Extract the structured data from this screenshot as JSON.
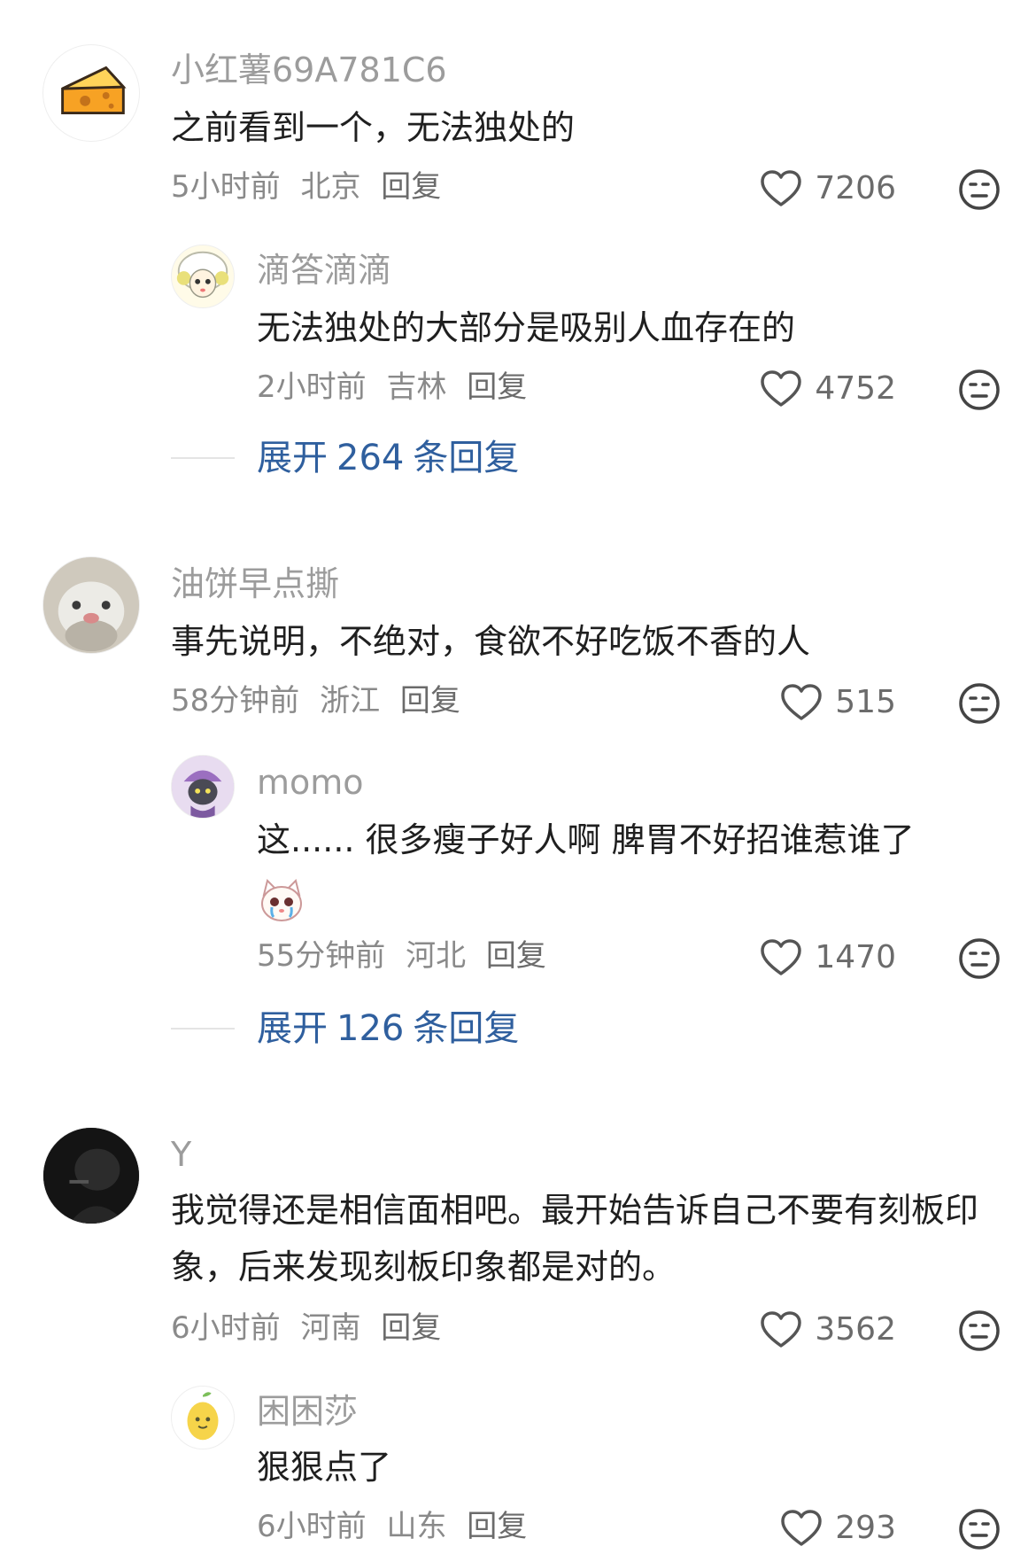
{
  "comments": [
    {
      "username": "小红薯69A781C6",
      "text": "之前看到一个，无法独处的",
      "time": "5小时前",
      "location": "北京",
      "reply_label": "回复",
      "likes": "7206",
      "replies": [
        {
          "username": "滴答滴滴",
          "text": "无法独处的大部分是吸别人血存在的",
          "time": "2小时前",
          "location": "吉林",
          "reply_label": "回复",
          "likes": "4752"
        }
      ],
      "expand": {
        "prefix": "展开",
        "count": "264",
        "suffix": "条回复"
      }
    },
    {
      "username": "油饼早点撕",
      "text": "事先说明，不绝对，食欲不好吃饭不香的人",
      "time": "58分钟前",
      "location": "浙江",
      "reply_label": "回复",
      "likes": "515",
      "replies": [
        {
          "username": "momo",
          "text": "这...... 很多瘦子好人啊 脾胃不好招谁惹谁了",
          "time": "55分钟前",
          "location": "河北",
          "reply_label": "回复",
          "likes": "1470"
        }
      ],
      "expand": {
        "prefix": "展开",
        "count": "126",
        "suffix": "条回复"
      }
    },
    {
      "username": "Y",
      "text": "我觉得还是相信面相吧。最开始告诉自己不要有刻板印象，后来发现刻板印象都是对的。",
      "time": "6小时前",
      "location": "河南",
      "reply_label": "回复",
      "likes": "3562",
      "replies": [
        {
          "username": "困困莎",
          "text": "狠狠点了",
          "time": "6小时前",
          "location": "山东",
          "reply_label": "回复",
          "likes": "293"
        }
      ]
    }
  ],
  "icons": {
    "like": "heart-outline-icon",
    "emoji": "emoji-face-icon"
  },
  "colors": {
    "username": "#9c9c9c",
    "meta": "#8a8a8a",
    "expand_link": "#2f5f9e",
    "avatar_cheese": "#f5a623"
  }
}
